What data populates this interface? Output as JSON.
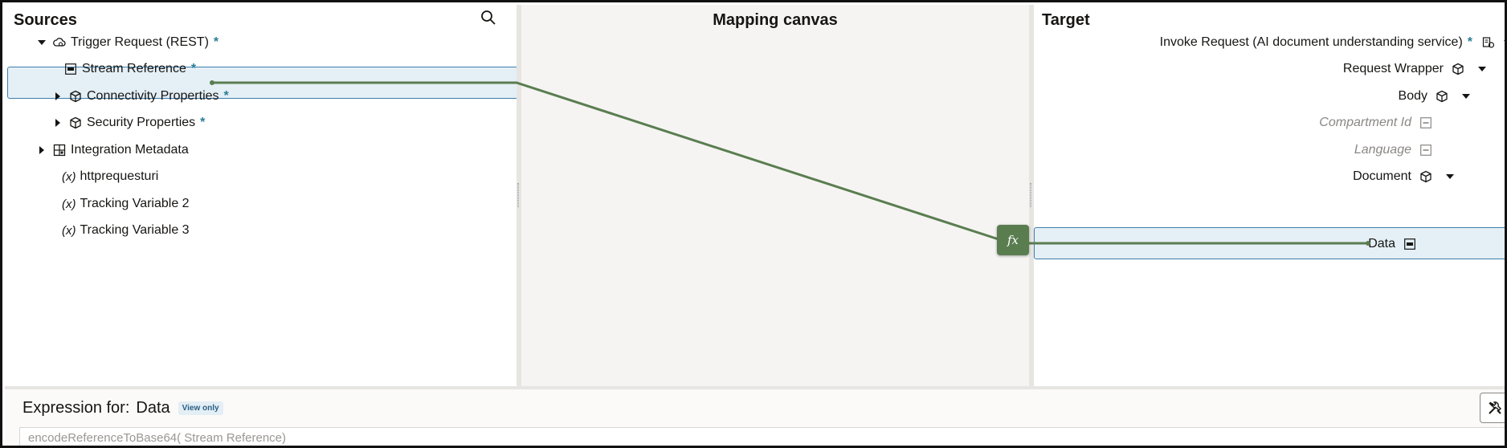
{
  "sources": {
    "title": "Sources",
    "search_icon": "search-icon",
    "items": [
      {
        "label": "Trigger Request (REST)",
        "required": "*",
        "icon": "cloud-rest-icon",
        "caret": "expanded"
      },
      {
        "label": "Stream Reference",
        "required": "*",
        "icon": "stream-field-icon",
        "selected": true
      },
      {
        "label": "Connectivity Properties",
        "required": "*",
        "icon": "cube-icon",
        "caret": "collapsed"
      },
      {
        "label": "Security Properties",
        "required": "*",
        "icon": "cube-icon",
        "caret": "collapsed"
      },
      {
        "label": "Integration Metadata",
        "icon": "grid-object-icon",
        "caret": "collapsed"
      },
      {
        "label": "httprequesturi",
        "prefix": "(x)"
      },
      {
        "label": "Tracking Variable 2",
        "prefix": "(x)"
      },
      {
        "label": "Tracking Variable 3",
        "prefix": "(x)"
      }
    ]
  },
  "canvas": {
    "title": "Mapping canvas",
    "function_node_label": "fx"
  },
  "target": {
    "title": "Target",
    "items": [
      {
        "label": "Invoke Request (AI document understanding service)",
        "required": "*",
        "icon": "ai-service-icon",
        "caret": "expanded"
      },
      {
        "label": "Request Wrapper",
        "icon": "cube-icon",
        "caret": "expanded"
      },
      {
        "label": "Body",
        "icon": "cube-icon",
        "caret": "expanded"
      },
      {
        "label": "Compartment Id",
        "icon": "string-field-icon",
        "optional": true
      },
      {
        "label": "Language",
        "icon": "string-field-icon",
        "optional": true
      },
      {
        "label": "Document",
        "icon": "cube-icon",
        "caret": "expanded"
      },
      {
        "label": "Data",
        "icon": "string-field-icon",
        "selected": true
      }
    ]
  },
  "expression": {
    "label": "Expression for:",
    "target_name": "Data",
    "badge": "View only",
    "value": "encodeReferenceToBase64( Stream Reference)",
    "tool_icon": "tools-icon"
  },
  "colors": {
    "mapping_line": "#5a7d50",
    "required_marker": "#2b7d96",
    "selection_fill": "#e4eff6",
    "selection_border": "#3e7fae"
  }
}
